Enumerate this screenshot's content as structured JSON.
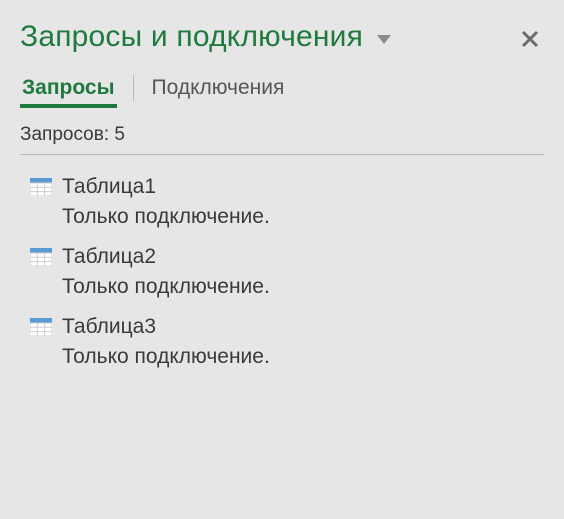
{
  "header": {
    "title": "Запросы и подключения"
  },
  "tabs": {
    "queries": "Запросы",
    "connections": "Подключения"
  },
  "count_label": "Запросов: 5",
  "queries": [
    {
      "name": "Таблица1",
      "status": "Только подключение."
    },
    {
      "name": "Таблица2",
      "status": "Только подключение."
    },
    {
      "name": "Таблица3",
      "status": "Только подключение."
    }
  ],
  "colors": {
    "accent": "#1f7a3e",
    "icon_blue": "#5b9bd5",
    "icon_grid": "#cfcfcf"
  }
}
